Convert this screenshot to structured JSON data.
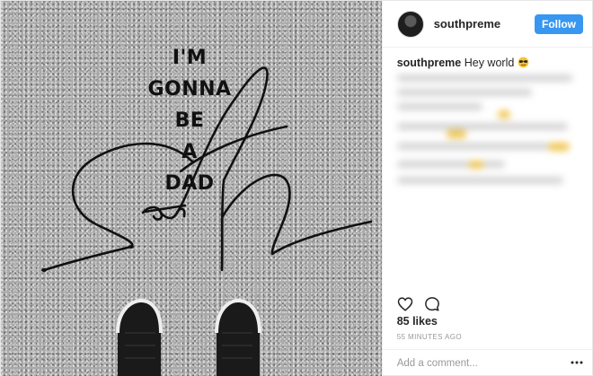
{
  "photo": {
    "text_lines": [
      "I'M",
      "GONNA",
      "BE",
      "A",
      "DAD"
    ],
    "signature_text": "Sth",
    "background_color": "#a9a9a9"
  },
  "header": {
    "username": "southpreme",
    "follow_label": "Follow",
    "follow_color": "#3897f0"
  },
  "caption": {
    "username": "southpreme",
    "text": "Hey world",
    "emoji": "smiling-face-with-sunglasses"
  },
  "actions": {
    "like_icon": "heart-icon",
    "comment_icon": "comment-icon"
  },
  "likes": "85 likes",
  "timestamp": "55 MINUTES AGO",
  "comment": {
    "placeholder": "Add a comment...",
    "more_icon": "more-options-icon"
  }
}
